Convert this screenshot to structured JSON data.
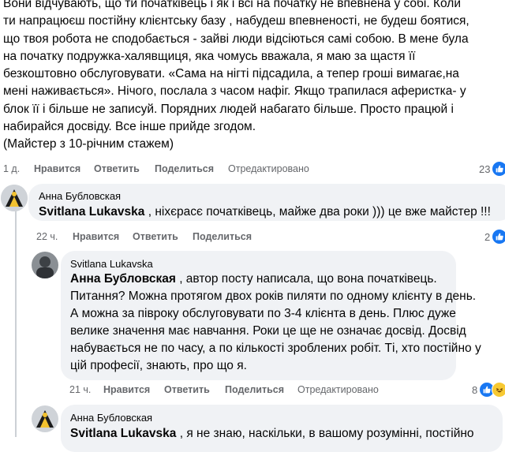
{
  "top_comment": {
    "lines": [
      "Вони відчувають, що ти початківець і як і всі на початку не впевнена у собі. Коли",
      "ти напрацюєш постійну клієнтську базу , набудеш впевненості, не будеш боятися,",
      "що твоя робота не сподобається - зайві люди відсіються самі собою. В мене була",
      "на початку подружка-халявщиця, яка чомусь вважала, я маю за щастя її",
      "безкоштовно обслуговувати. «Сама на нігті підсадила, а тепер гроші вимагає,на",
      "мені наживається». Нічого, послала з часом нафіг. Якщо трапилася аферистка- у",
      "блок її і більше не записуй. Порядних людей набагато більше. Просто працюй і",
      "набирайся досвіду. Все інше прийде згодом.",
      "(Майстер з 10-річним стажем)"
    ],
    "time": "1 д.",
    "like": "Нравится",
    "reply": "Ответить",
    "share": "Поделиться",
    "edited": "Отредактировано",
    "reaction_count": "23"
  },
  "reply1": {
    "author": "Анна Бубловская",
    "mention": "Svitlana Lukavska",
    "text": " , ніхєрасє початківець, майже два роки ))) це вже майстер !!!",
    "time": "22 ч.",
    "like": "Нравится",
    "reply": "Ответить",
    "share": "Поделиться",
    "reaction_count": "2"
  },
  "reply2": {
    "author": "Svitlana Lukavska",
    "mention": "Анна Бубловская",
    "first_line_rest": " , автор посту написала, що вона початківець.",
    "lines": [
      "Питання? Можна протягом двох років пиляти по одному клієнту в день.",
      "А можна за півроку обслуговувати по 3-4 клієнта в день. Плюс дуже",
      "велике значення має навчання. Роки це ще не означає досвід. Досвід",
      "набувається не по часу, а по кількості зроблених робіт. Ті, хто постійно у",
      "цій професії, знають, про що я."
    ],
    "time": "21 ч.",
    "like": "Нравится",
    "reply": "Ответить",
    "share": "Поделиться",
    "edited": "Отредактировано",
    "reaction_count": "8"
  },
  "reply3": {
    "author": "Анна Бубловская",
    "mention": "Svitlana Lukavska",
    "text": " , я не знаю, наскільки, в вашому розумінні, постійно"
  },
  "colors": {
    "like_blue": "#1877f2",
    "bubble_bg": "#f0f2f5",
    "meta_gray": "#65676b"
  }
}
